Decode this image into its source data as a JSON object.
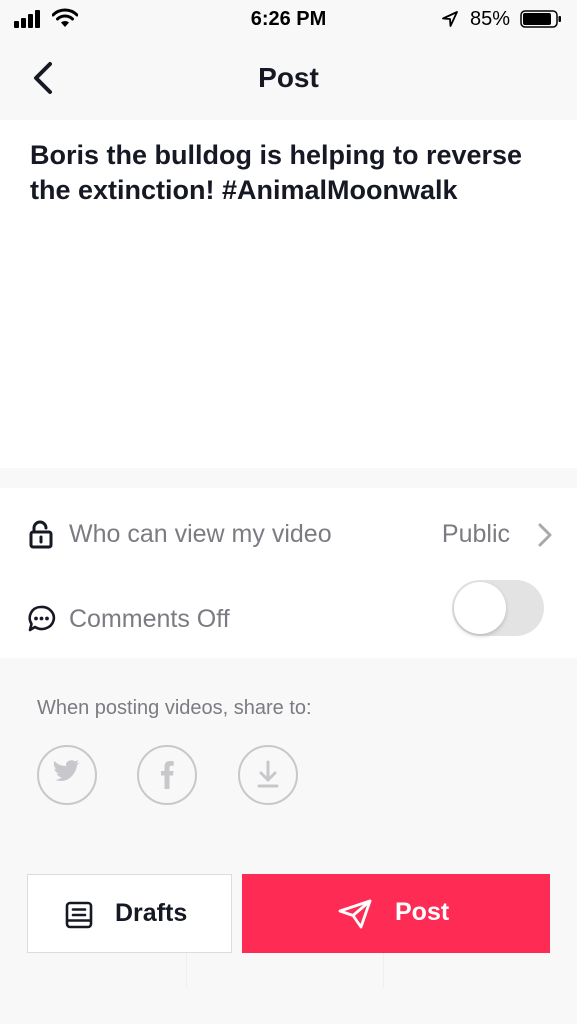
{
  "status_bar": {
    "time": "6:26 PM",
    "battery_percent": "85%",
    "icons": [
      "signal-icon",
      "wifi-icon",
      "location-arrow-icon",
      "battery-icon"
    ]
  },
  "header": {
    "title": "Post",
    "back_icon": "chevron-left-icon"
  },
  "caption": {
    "text": "Boris the bulldog is helping to reverse the extinction! #AnimalMoonwalk"
  },
  "settings": {
    "privacy": {
      "label": "Who can view my video",
      "value": "Public",
      "icon": "unlock-icon"
    },
    "comments": {
      "label": "Comments Off",
      "icon": "comment-icon",
      "toggle_on": false
    }
  },
  "share": {
    "label": "When posting videos, share to:",
    "targets": [
      "twitter-icon",
      "facebook-icon",
      "download-icon"
    ]
  },
  "actions": {
    "drafts_label": "Drafts",
    "post_label": "Post",
    "post_color": "#fe2c55"
  }
}
